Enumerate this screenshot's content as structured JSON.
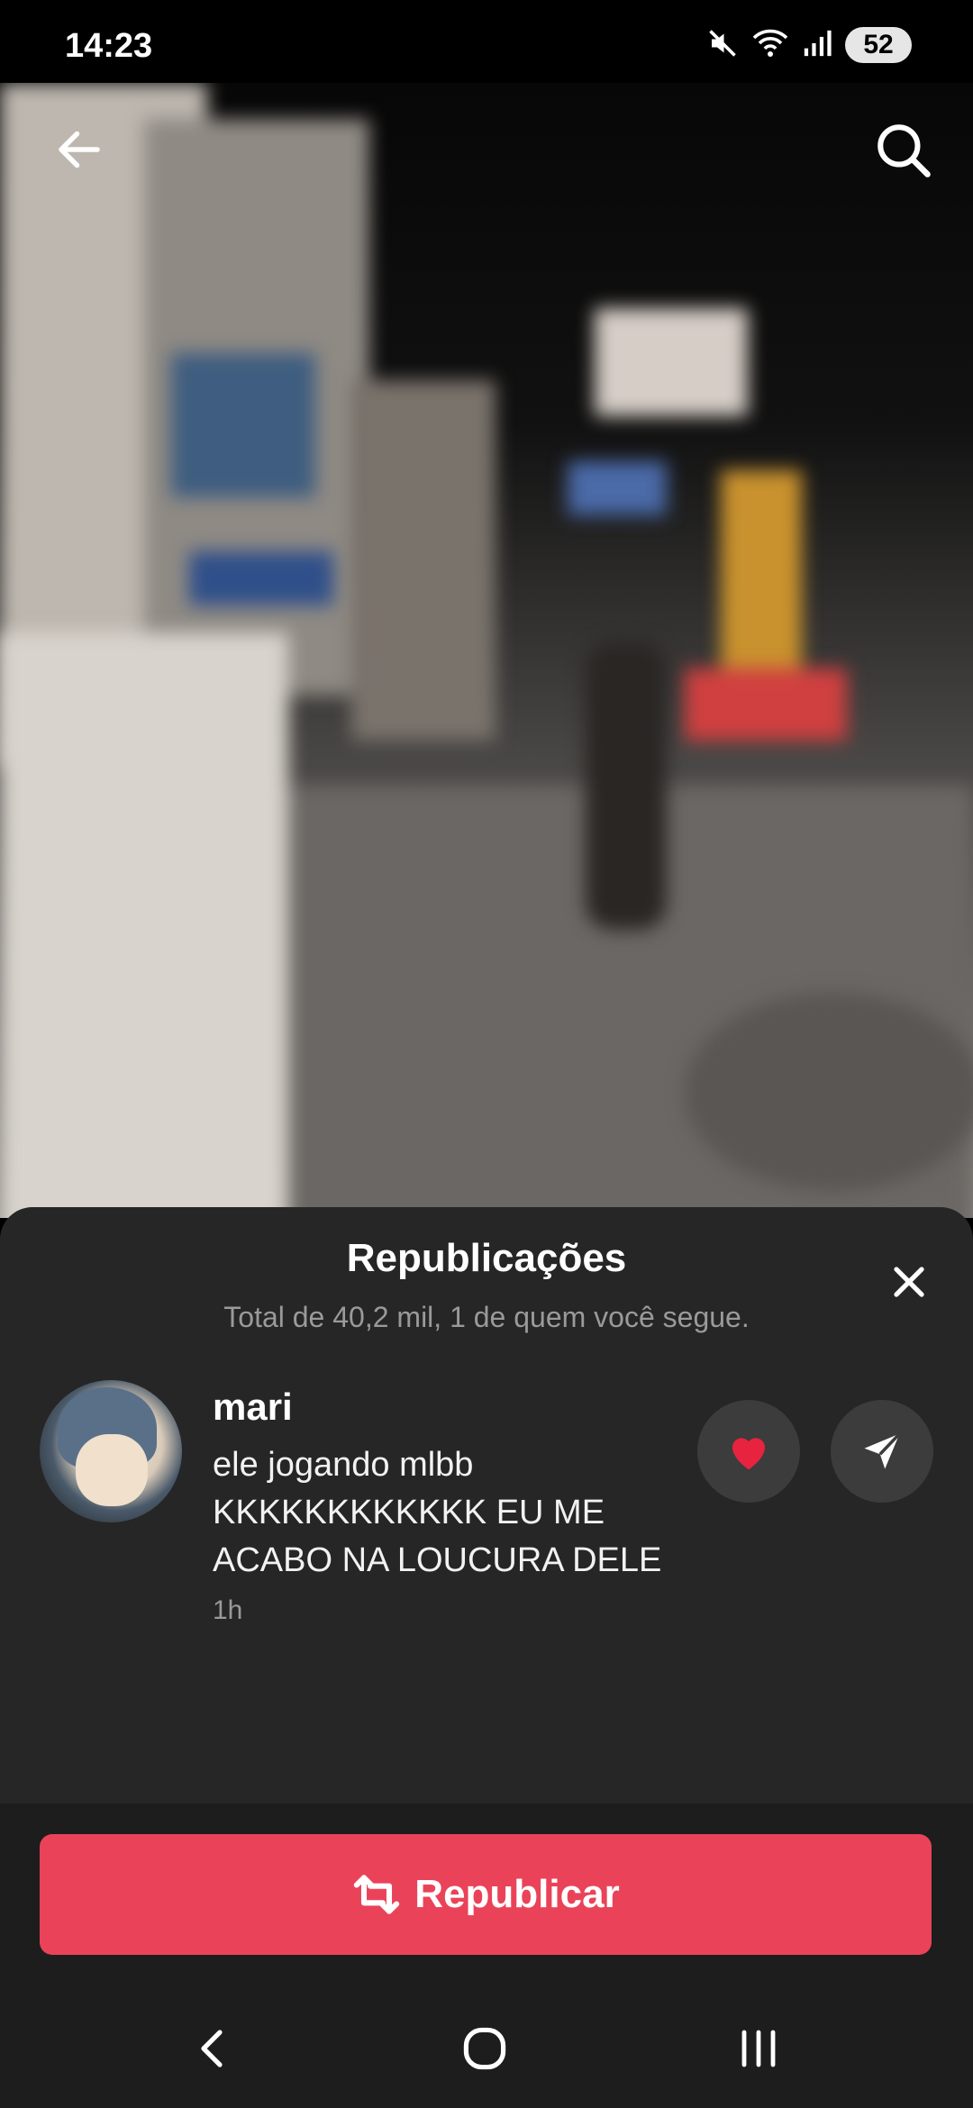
{
  "status_bar": {
    "time": "14:23",
    "icons": [
      "mute-icon",
      "wifi-icon",
      "signal-icon"
    ],
    "battery": "52"
  },
  "video": {
    "top_icons": [
      "back-arrow-icon",
      "search-icon"
    ]
  },
  "sheet": {
    "title": "Republicações",
    "subtitle": "Total de 40,2 mil, 1 de quem você segue.",
    "close_icon": "close-icon",
    "repost_items": [
      {
        "username": "mari",
        "comment": "ele jogando mlbb KKKKKKKKKKKK EU ME ACABO NA LOUCURA DELE",
        "time": "1h",
        "actions": [
          "heart-icon",
          "send-icon"
        ]
      }
    ]
  },
  "repost_button": {
    "label": "Republicar",
    "icon": "repost-icon",
    "color": "#ea4359"
  },
  "nav_bar": {
    "icons": [
      "back-nav-icon",
      "home-nav-icon",
      "recents-nav-icon"
    ]
  },
  "colors": {
    "sheet_bg": "#262626",
    "accent": "#ea4359",
    "heart": "#e8233f"
  }
}
